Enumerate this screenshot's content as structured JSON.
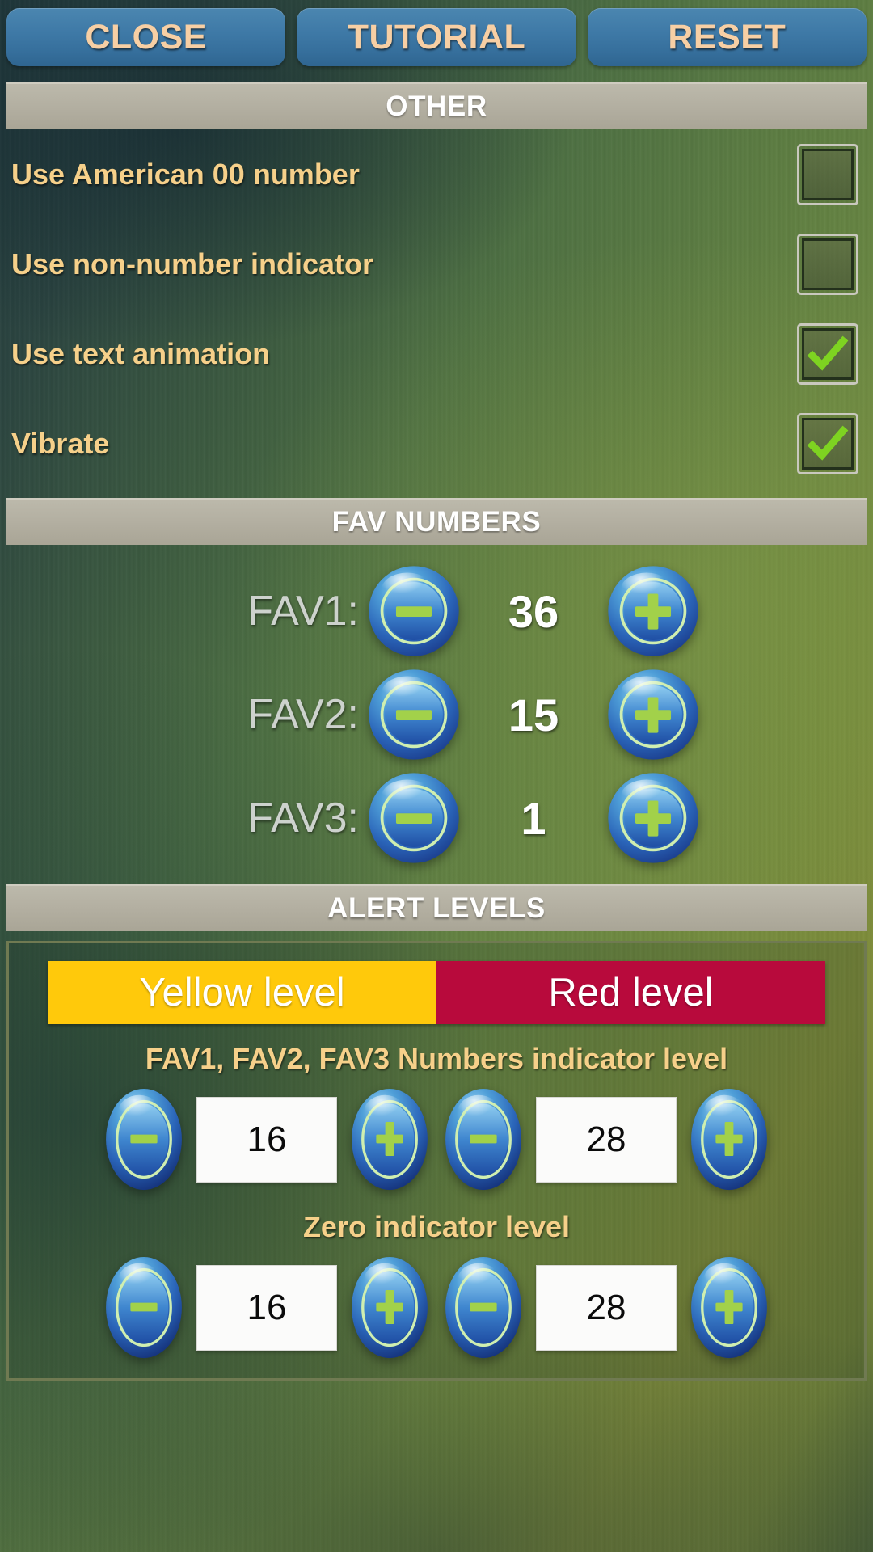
{
  "topbar": {
    "buttons": [
      {
        "name": "close",
        "label": "CLOSE"
      },
      {
        "name": "tutorial",
        "label": "TUTORIAL"
      },
      {
        "name": "reset",
        "label": "RESET"
      }
    ],
    "button_color": "#3f7aa7",
    "label_color": "#f7cfa4"
  },
  "sections": {
    "other": "OTHER",
    "fav_numbers": "FAV NUMBERS",
    "alert_levels": "ALERT LEVELS"
  },
  "other_options": [
    {
      "label": "Use American 00 number",
      "checked": false
    },
    {
      "label": "Use non-number indicator",
      "checked": false
    },
    {
      "label": "Use text animation",
      "checked": true
    },
    {
      "label": "Vibrate",
      "checked": true
    }
  ],
  "fav_numbers": [
    {
      "label": "FAV1:",
      "value": "36"
    },
    {
      "label": "FAV2:",
      "value": "15"
    },
    {
      "label": "FAV3:",
      "value": "1"
    }
  ],
  "alert_levels": {
    "tabs": [
      {
        "label": "Yellow level",
        "color": "#ffc90b"
      },
      {
        "label": "Red level",
        "color": "#b80a3c"
      }
    ],
    "groups": [
      {
        "caption": "FAV1, FAV2, FAV3 Numbers indicator level",
        "yellow_value": "16",
        "red_value": "28"
      },
      {
        "caption": "Zero indicator level",
        "yellow_value": "16",
        "red_value": "28"
      }
    ]
  },
  "icons": {
    "minus": "minus-orb-icon",
    "plus": "plus-orb-icon",
    "check": "checkmark-icon"
  },
  "colors": {
    "label_gold": "#f6d08a",
    "fav_label_grey": "#cdd2cd",
    "section_bar": "#b2aea0",
    "check_green": "#7ed321"
  }
}
